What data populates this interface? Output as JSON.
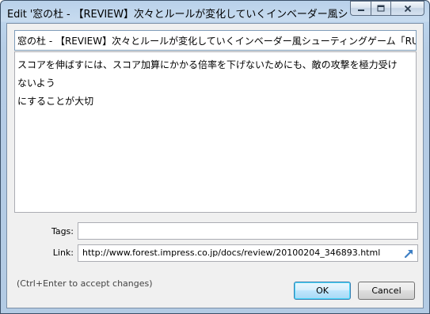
{
  "window": {
    "title": "Edit '窓の杜 - 【REVIEW】次々とルールが変化していくインベーダー風シュ...",
    "minimize_glyph": "—",
    "maximize_glyph": "□",
    "close_glyph": "✕"
  },
  "note": {
    "title_value": "窓の杜 - 【REVIEW】次々とルールが変化していくインベーダー風シューティングゲーム「RULES」",
    "body_line1": "スコアを伸ばすには、スコア加算にかかる倍率を下げないためにも、敵の攻撃を極力受けないよう",
    "body_line2": "にすることが大切"
  },
  "fields": {
    "tags_label": "Tags:",
    "tags_value": "",
    "link_label": "Link:",
    "link_value": "http://www.forest.impress.co.jp/docs/review/20100204_346893.html"
  },
  "footer": {
    "hint": "(Ctrl+Enter to accept changes)",
    "ok_label": "OK",
    "cancel_label": "Cancel"
  }
}
